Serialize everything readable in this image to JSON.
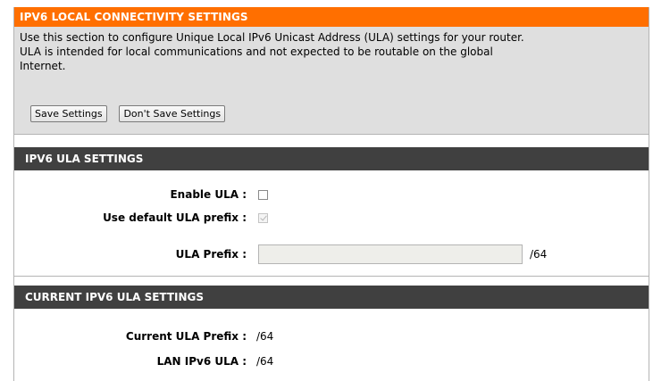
{
  "local_conn": {
    "title": "IPV6 LOCAL CONNECTIVITY SETTINGS",
    "description_line1": "Use this section to configure Unique Local IPv6 Unicast Address (ULA) settings for your router.",
    "description_line2": "ULA is intended for local communications and not expected to be routable on the global",
    "description_line3": "Internet.",
    "save_label": "Save Settings",
    "dont_save_label": "Don't Save Settings"
  },
  "ula_settings": {
    "title": "IPV6 ULA SETTINGS",
    "enable_label": "Enable ULA :",
    "enable_checked": false,
    "default_prefix_label": "Use default ULA prefix :",
    "default_prefix_checked": true,
    "default_prefix_disabled": true,
    "prefix_label": "ULA Prefix :",
    "prefix_value": "",
    "prefix_suffix": "/64"
  },
  "current_settings": {
    "title": "CURRENT IPV6 ULA SETTINGS",
    "current_prefix_label": "Current ULA Prefix :",
    "current_prefix_value": "/64",
    "lan_ula_label": "LAN IPv6 ULA :",
    "lan_ula_value": "/64"
  },
  "colors": {
    "orange_header": "#ff6f00",
    "dark_header": "#404040",
    "panel_gray": "#dfdfdf"
  }
}
